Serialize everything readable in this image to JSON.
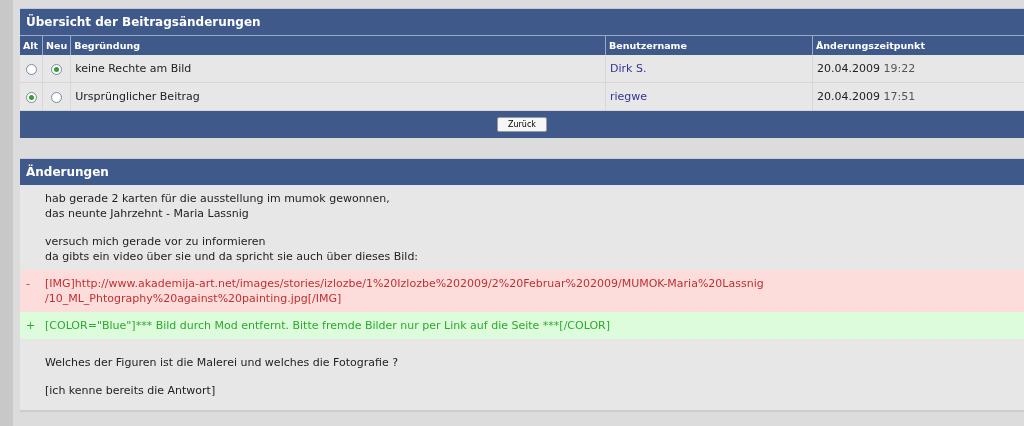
{
  "overview": {
    "title": "Übersicht der Beitragsänderungen",
    "columns": [
      "Alt",
      "Neu",
      "Begründung",
      "Benutzername",
      "Änderungszeitpunkt"
    ],
    "rows": [
      {
        "old_selected": false,
        "new_selected": true,
        "reason": "keine Rechte am Bild",
        "user": "Dirk S.",
        "date": "20.04.2009",
        "time": "19:22"
      },
      {
        "old_selected": true,
        "new_selected": false,
        "reason": "Ursprünglicher Beitrag",
        "user": "riegwe",
        "date": "20.04.2009",
        "time": "17:51"
      }
    ],
    "back_button": "Zurück"
  },
  "changes": {
    "title": "Änderungen",
    "blocks": [
      {
        "kind": "context",
        "paragraphs": [
          "hab gerade 2 karten für die ausstellung im mumok gewonnen,\ndas neunte Jahrzehnt - Maria Lassnig",
          "versuch mich gerade vor zu informieren\nda gibts ein video über sie und da spricht sie auch über dieses Bild:"
        ]
      },
      {
        "kind": "removed",
        "marker": "-",
        "text": "[IMG]http://www.akademija-art.net/images/stories/izlozbe/1%20Izlozbe%202009/2%20Februar%202009/MUMOK-Maria%20Lassnig\n/10_ML_Phtography%20against%20painting.jpg[/IMG]"
      },
      {
        "kind": "added",
        "marker": "+",
        "text": "[COLOR=\"Blue\"]*** Bild durch Mod entfernt. Bitte fremde Bilder nur per Link auf die Seite ***[/COLOR]"
      },
      {
        "kind": "context",
        "paragraphs": [
          "Welches der Figuren ist die Malerei und welches die Fotografie ?",
          "[ich kenne bereits die Antwort]"
        ]
      }
    ]
  }
}
